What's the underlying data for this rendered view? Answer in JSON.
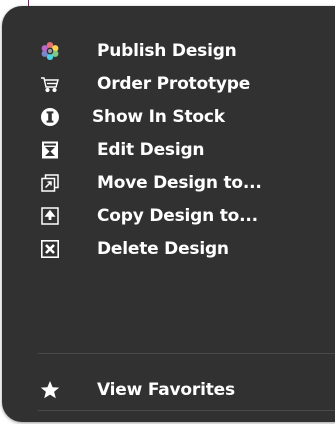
{
  "menu": {
    "items": [
      {
        "name": "publish-design",
        "label": "Publish Design",
        "icon": "flower-icon"
      },
      {
        "name": "order-prototype",
        "label": "Order Prototype",
        "icon": "cart-icon"
      },
      {
        "name": "show-in-stock",
        "label": "Show In Stock",
        "icon": "info-circle-icon"
      },
      {
        "name": "edit-design",
        "label": "Edit Design",
        "icon": "edit-stamp-icon"
      },
      {
        "name": "move-design",
        "label": "Move Design to...",
        "icon": "move-icon"
      },
      {
        "name": "copy-design",
        "label": "Copy Design to...",
        "icon": "copy-icon"
      },
      {
        "name": "delete-design",
        "label": "Delete Design",
        "icon": "delete-box-icon"
      }
    ],
    "favorites": {
      "label": "View Favorites",
      "icon": "star-icon"
    }
  },
  "colors": {
    "menu_background": "#313131",
    "text": "#ffffff",
    "divider": "#4a4a4a"
  }
}
